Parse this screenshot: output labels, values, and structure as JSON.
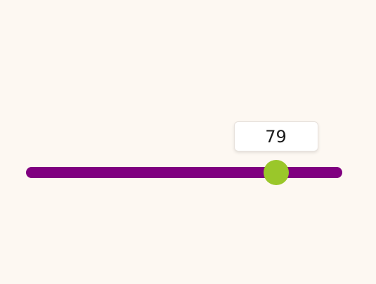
{
  "slider": {
    "value": "79",
    "min": 0,
    "max": 100,
    "track_color": "#800080",
    "thumb_color": "#9ac72a"
  }
}
